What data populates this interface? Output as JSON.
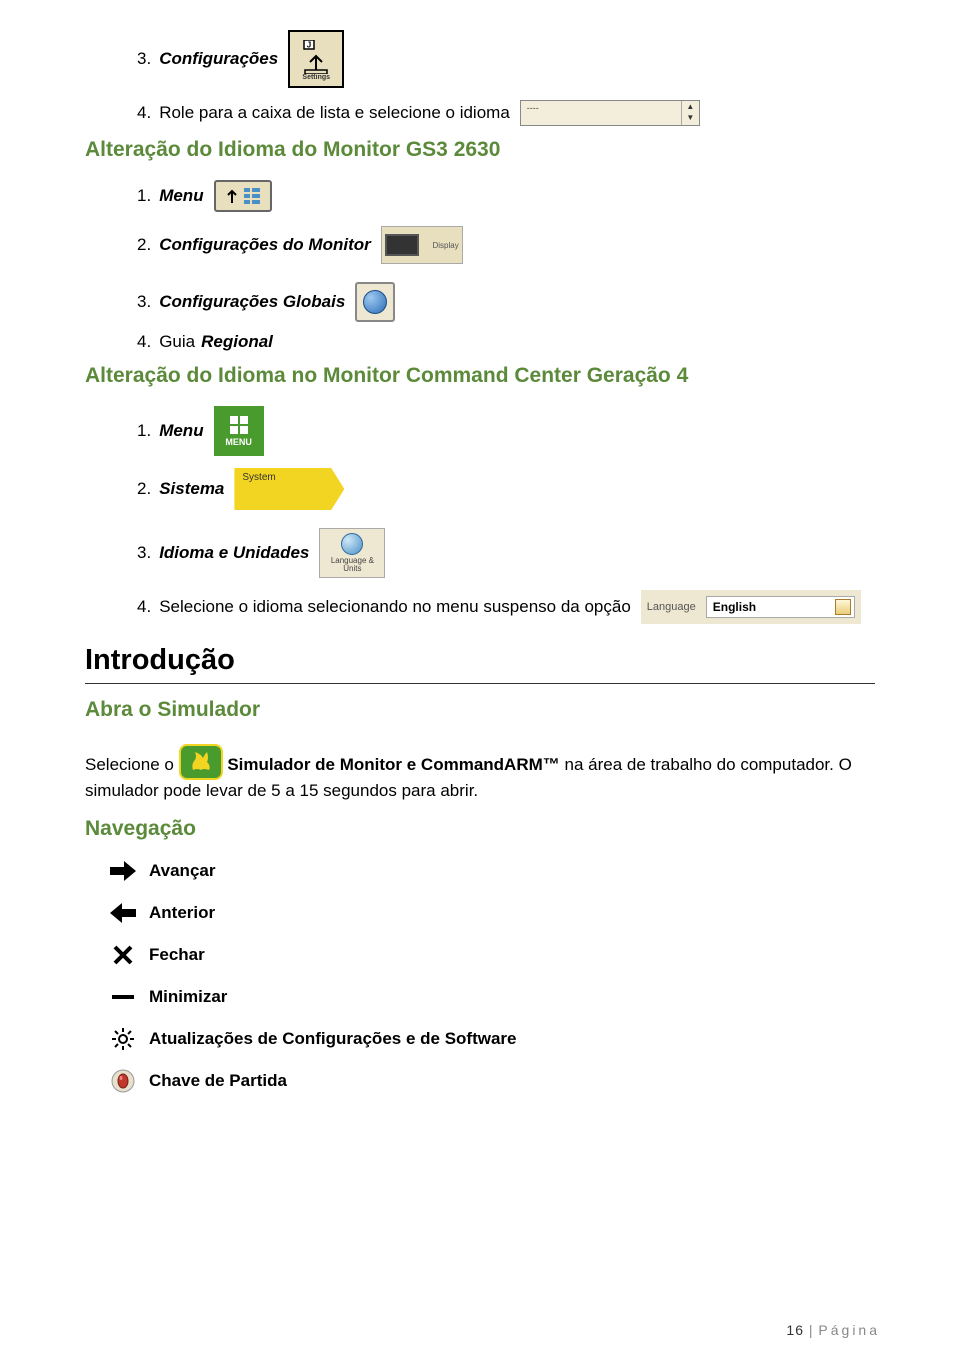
{
  "s1": {
    "item3": {
      "num": "3.",
      "label": "Configurações",
      "icon_label": "Settings"
    },
    "item4": {
      "num": "4.",
      "text": "Role para a caixa de lista e selecione o idioma",
      "dropdown_dashes": "----"
    }
  },
  "h1": "Alteração do Idioma do Monitor GS3 2630",
  "s2": {
    "item1": {
      "num": "1.",
      "label": "Menu"
    },
    "item2": {
      "num": "2.",
      "label": "Configurações do Monitor",
      "icon_label": "Display"
    },
    "item3": {
      "num": "3.",
      "label": "Configurações Globais"
    },
    "item4": {
      "num": "4.",
      "pre": "Guia",
      "label": "Regional"
    }
  },
  "h2": "Alteração do Idioma no Monitor Command Center Geração 4",
  "s3": {
    "item1": {
      "num": "1.",
      "label": "Menu",
      "icon_label": "MENU"
    },
    "item2": {
      "num": "2.",
      "label": "Sistema",
      "icon_label": "System"
    },
    "item3": {
      "num": "3.",
      "label": "Idioma e Unidades",
      "icon_line1": "Language &",
      "icon_line2": "Units"
    },
    "item4": {
      "num": "4.",
      "text": "Selecione o idioma selecionando no menu suspenso da opção",
      "field_label": "Language",
      "field_value": "English"
    }
  },
  "intro": {
    "heading": "Introdução",
    "sub": "Abra o Simulador"
  },
  "sim": {
    "pre": "Selecione o ",
    "bold": "Simulador de Monitor e CommandARM™",
    "post": " na área de trabalho do computador. O simulador pode levar de 5 a 15 segundos para abrir."
  },
  "nav_heading": "Navegação",
  "nav": {
    "forward": "Avançar",
    "back": "Anterior",
    "close": "Fechar",
    "minimize": "Minimizar",
    "updates": "Atualizações de Configurações e de Software",
    "key": "Chave de Partida"
  },
  "footer": {
    "num": "16",
    "sep": " | ",
    "text": "Página"
  }
}
